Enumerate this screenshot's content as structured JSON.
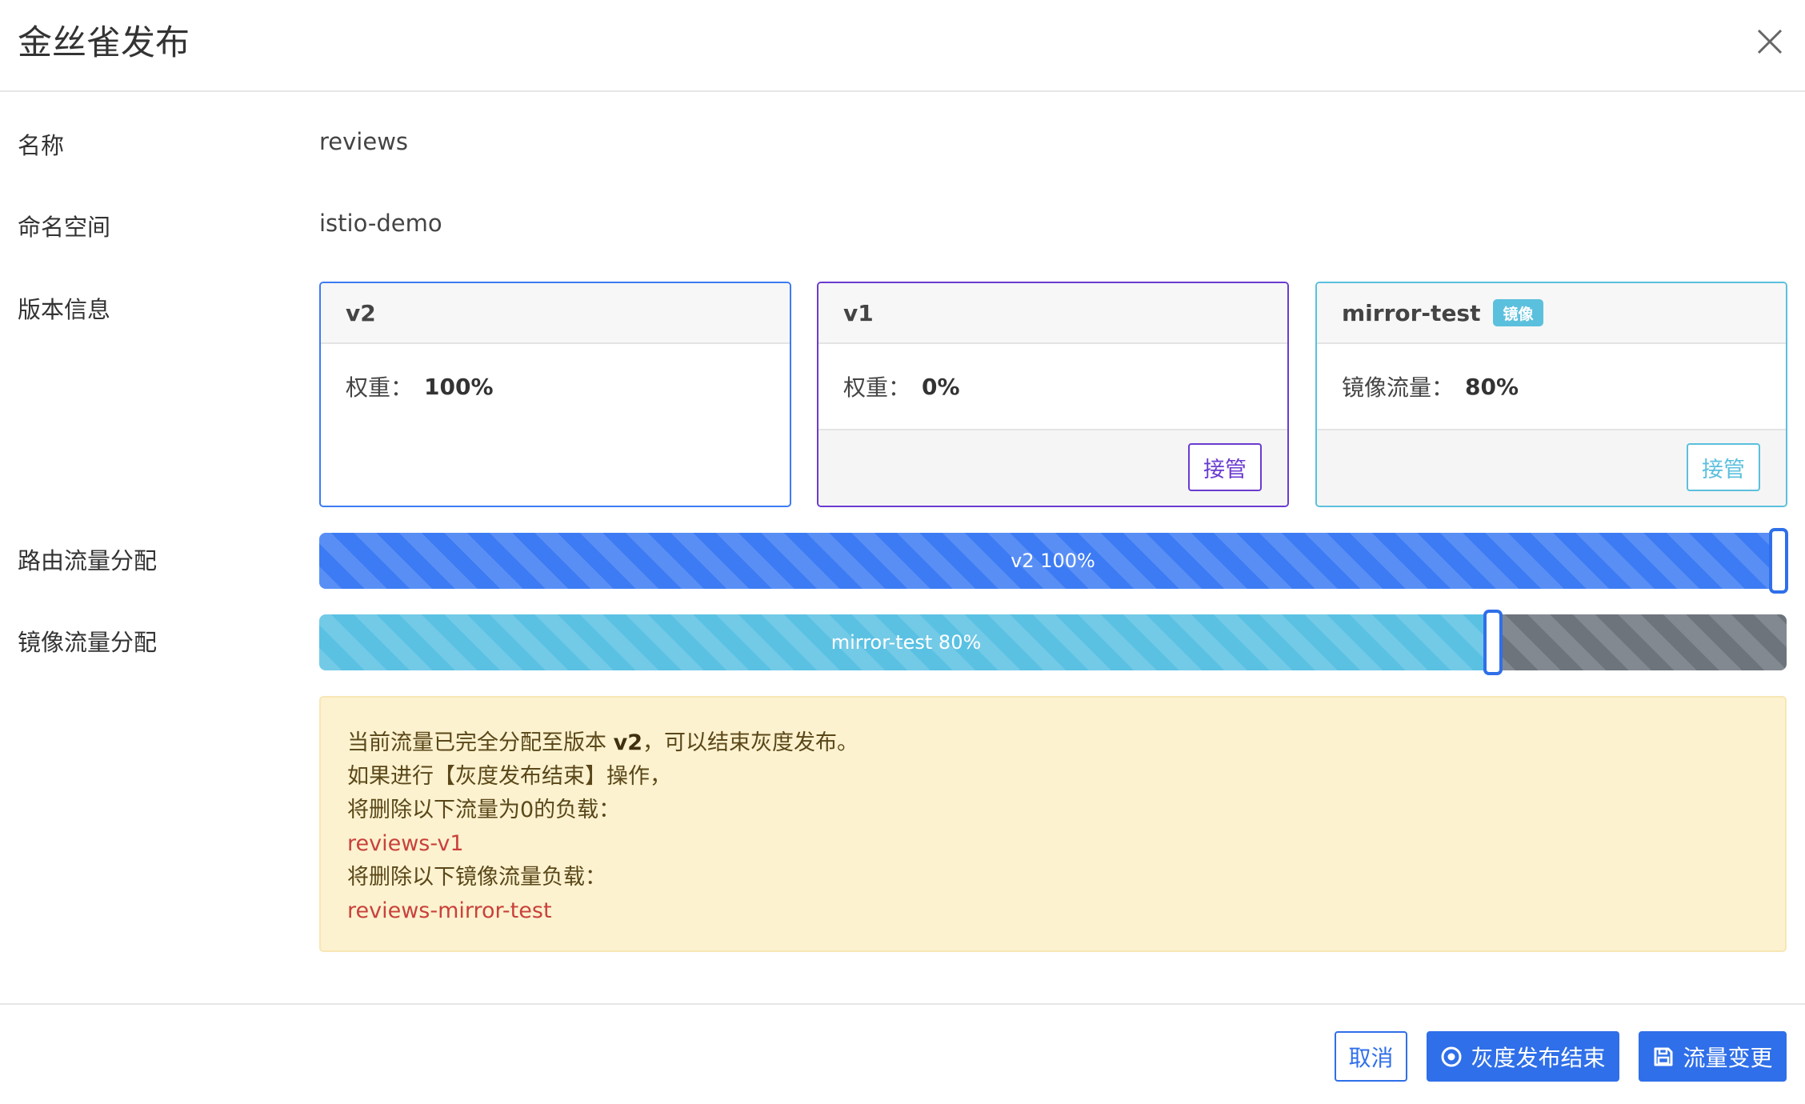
{
  "dialog": {
    "title": "金丝雀发布"
  },
  "fields": {
    "name_label": "名称",
    "name_value": "reviews",
    "namespace_label": "命名空间",
    "namespace_value": "istio-demo",
    "version_label": "版本信息",
    "route_label": "路由流量分配",
    "mirror_label": "镜像流量分配"
  },
  "versions": [
    {
      "name": "v2",
      "metric_label": "权重：",
      "metric_value": "100%",
      "color": "#3c7bf3"
    },
    {
      "name": "v1",
      "metric_label": "权重：",
      "metric_value": "0%",
      "action": "接管",
      "color": "#6a3bd1"
    },
    {
      "name": "mirror-test",
      "badge": "镜像",
      "metric_label": "镜像流量：",
      "metric_value": "80%",
      "action": "接管",
      "color": "#5bc0de"
    }
  ],
  "route_bar": {
    "label": "v2 100%",
    "percent": 100
  },
  "mirror_bar": {
    "label": "mirror-test 80%",
    "percent": 80
  },
  "alert": {
    "line1_pre": "当前流量已完全分配至版本 ",
    "line1_version": "v2",
    "line1_post": "，可以结束灰度发布。",
    "line2": "如果进行【灰度发布结束】操作，",
    "line3": "将删除以下流量为0的负载：",
    "line4": "reviews-v1",
    "line5": "将删除以下镜像流量负载：",
    "line6": "reviews-mirror-test"
  },
  "footer": {
    "cancel": "取消",
    "finish": "灰度发布结束",
    "change": "流量变更"
  }
}
